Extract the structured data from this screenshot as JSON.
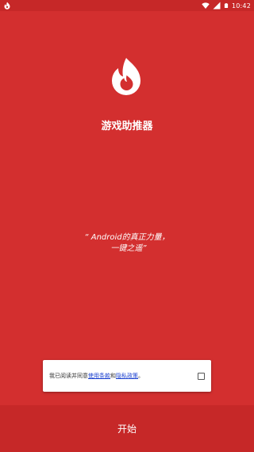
{
  "status_bar": {
    "app_icon": "flame-icon",
    "wifi_icon": "wifi-icon",
    "signal_icon": "signal-icon",
    "battery_icon": "battery-icon",
    "time": "10:42"
  },
  "main": {
    "logo_icon": "flame-logo-icon",
    "title": "游戏助推器",
    "slogan_line1": "“ Android的真正力量，",
    "slogan_line2": "一键之遥”"
  },
  "consent": {
    "prefix": "我已阅读并同意",
    "terms_link": "使用条款",
    "connector": "和",
    "privacy_link": "隐私政策",
    "suffix": "。",
    "checked": false
  },
  "start_button": {
    "label": "开始"
  },
  "colors": {
    "background": "#d32f2f",
    "bar": "#c62828",
    "link": "#1a3fcf"
  }
}
